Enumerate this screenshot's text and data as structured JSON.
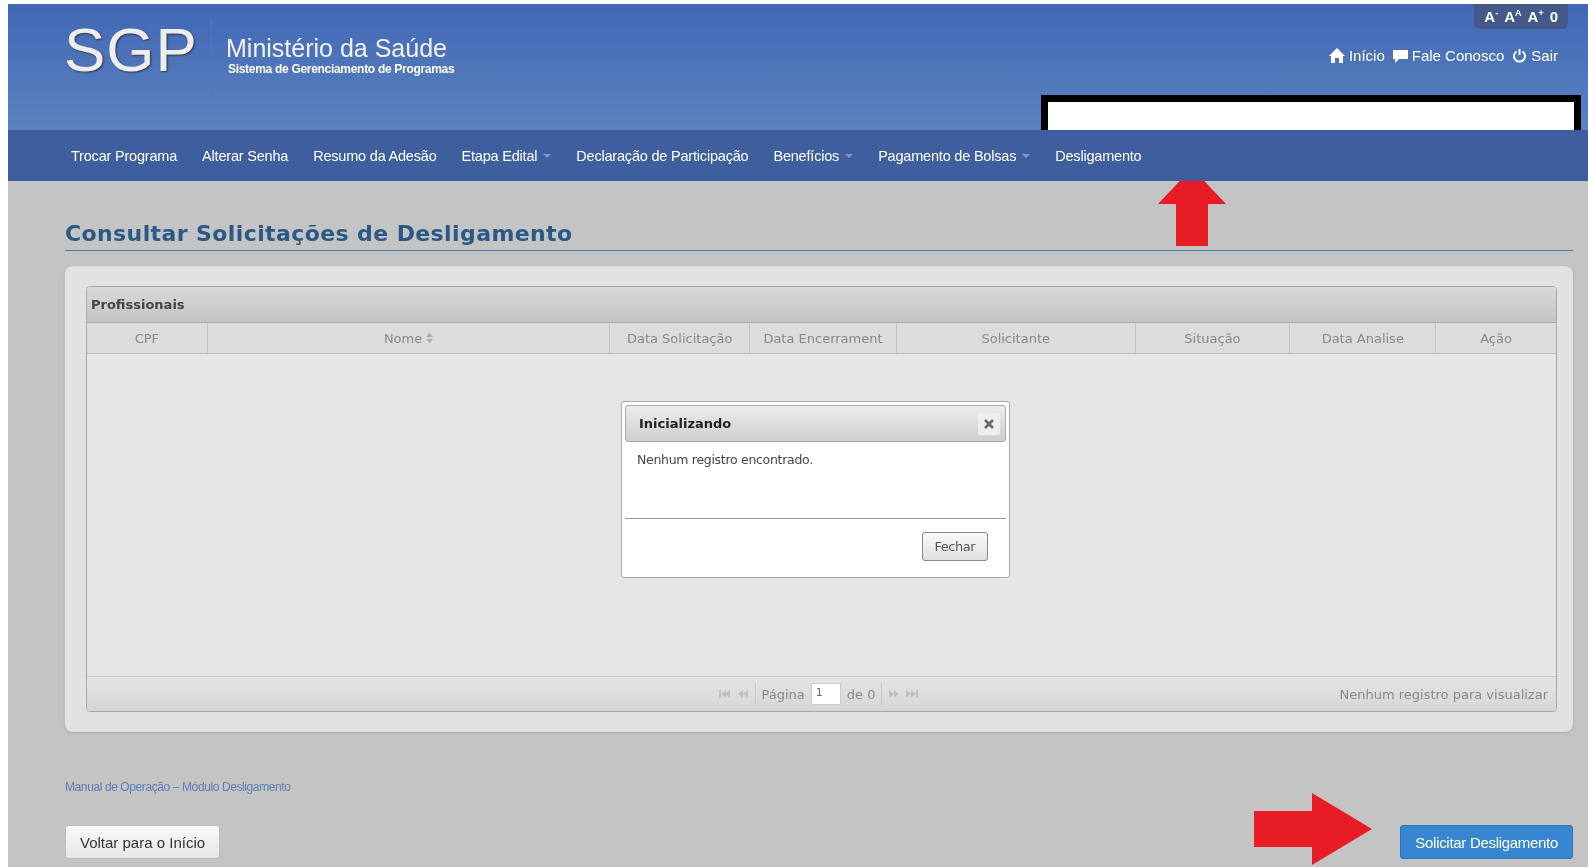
{
  "header": {
    "logo": "SGP",
    "title": "Ministério da Saúde",
    "subtitle": "Sistema de Gerenciamento de Programas",
    "font_controls": [
      "A$^{-}$",
      "A$^{A}$",
      "A$^{+}$",
      "0"
    ],
    "links": [
      "Início",
      "Fale Conosco",
      "Sair"
    ]
  },
  "nav": [
    {
      "label": "Trocar Programa",
      "dropdown": false
    },
    {
      "label": "Alterar Senha",
      "dropdown": false
    },
    {
      "label": "Resumo da Adesão",
      "dropdown": false
    },
    {
      "label": "Etapa Edital",
      "dropdown": true
    },
    {
      "label": "Declaração de Participação",
      "dropdown": false
    },
    {
      "label": "Benefícios",
      "dropdown": true
    },
    {
      "label": "Pagamento de Bolsas",
      "dropdown": true
    },
    {
      "label": "Desligamento",
      "dropdown": false
    }
  ],
  "page_title": "Consultar Solicitações de Desligamento",
  "grid": {
    "caption": "Profissionais",
    "columns": [
      {
        "label": "CPF",
        "sorted": false
      },
      {
        "label": "Nome",
        "sorted": true
      },
      {
        "label": "Data Solicitação",
        "sorted": false
      },
      {
        "label": "Data Encerrament",
        "sorted": false
      },
      {
        "label": "Solicitante",
        "sorted": false
      },
      {
        "label": "Situação",
        "sorted": false
      },
      {
        "label": "Data Analise",
        "sorted": false
      },
      {
        "label": "Ação",
        "sorted": false
      }
    ],
    "pager": {
      "page_label": "Página",
      "page": "1",
      "of_label": "de 0",
      "status": "Nenhum registro para visualizar"
    }
  },
  "dialog": {
    "title": "Inicializando",
    "message": "Nenhum registro encontrado.",
    "button": "Fechar"
  },
  "manual_link": "Manual de Operação – Módulo Desligamento",
  "buttons": [
    {
      "label": "Voltar para o Início",
      "kind": "default"
    },
    {
      "label": "Solicitar Desligamento",
      "kind": "primary"
    }
  ]
}
